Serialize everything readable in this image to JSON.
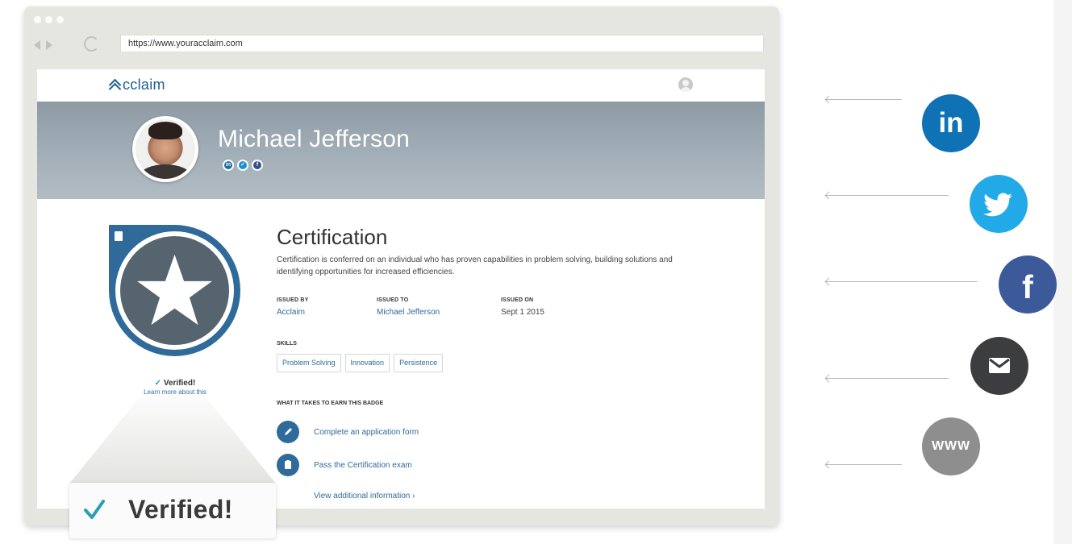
{
  "browser": {
    "url": "https://www.youracclaim.com"
  },
  "site": {
    "logo_text": "cclaim",
    "brand_color": "#1e5e93"
  },
  "profile": {
    "name": "Michael Jefferson",
    "social_icons": [
      "linkedin-icon",
      "twitter-icon",
      "facebook-icon"
    ]
  },
  "badge": {
    "title": "Certification",
    "description": "Certification is conferred on an individual who has proven capabilities in problem solving, building solutions and identifying opportunities for increased efficiencies.",
    "issued_by_label": "ISSUED BY",
    "issued_by": "Acclaim",
    "issued_to_label": "ISSUED TO",
    "issued_to": "Michael Jefferson",
    "issued_on_label": "ISSUED ON",
    "issued_on": "Sept 1 2015",
    "skills_label": "SKILLS",
    "skills": [
      "Problem Solving",
      "Innovation",
      "Persistence"
    ],
    "earn_label": "WHAT IT TAKES TO EARN THIS BADGE",
    "steps": [
      "Complete an application form",
      "Pass the Certification exam"
    ],
    "view_more": "View additional information ›",
    "verified_small": "Verified!",
    "verified_check": "✓",
    "learn_more": "Learn more about this",
    "verified_big": "Verified!",
    "badge_color": "#2f6a9b",
    "badge_core_color": "#55646f"
  },
  "share": {
    "linkedin": "in",
    "facebook": "f",
    "www": "WWW",
    "colors": {
      "linkedin": "#0e72b5",
      "twitter": "#22a9e7",
      "facebook": "#3c5a9a",
      "email": "#3c3d3e",
      "www": "#8e8e8e"
    }
  }
}
